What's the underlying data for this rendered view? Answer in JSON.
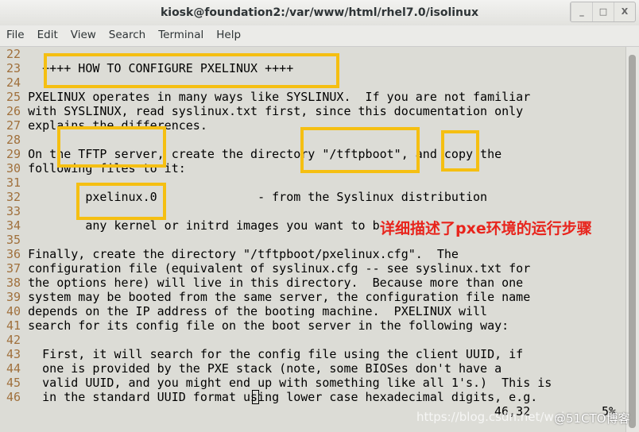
{
  "window": {
    "title": "kiosk@foundation2:/var/www/html/rhel7.0/isolinux",
    "buttons": [
      "_",
      "□",
      "X"
    ]
  },
  "menu": [
    "File",
    "Edit",
    "View",
    "Search",
    "Terminal",
    "Help"
  ],
  "lines": [
    {
      "n": "22",
      "t": ""
    },
    {
      "n": "23",
      "t": "  ++++ HOW TO CONFIGURE PXELINUX ++++"
    },
    {
      "n": "24",
      "t": ""
    },
    {
      "n": "25",
      "t": "PXELINUX operates in many ways like SYSLINUX.  If you are not familiar"
    },
    {
      "n": "26",
      "t": "with SYSLINUX, read syslinux.txt first, since this documentation only"
    },
    {
      "n": "27",
      "t": "explains the differences."
    },
    {
      "n": "28",
      "t": ""
    },
    {
      "n": "29",
      "t": "On the TFTP server, create the directory \"/tftpboot\", and copy the"
    },
    {
      "n": "30",
      "t": "following files to it:"
    },
    {
      "n": "31",
      "t": ""
    },
    {
      "n": "32",
      "t": "        pxelinux.0              - from the Syslinux distribution"
    },
    {
      "n": "33",
      "t": ""
    },
    {
      "n": "34",
      "t": "        any kernel or initrd images you want to boot"
    },
    {
      "n": "35",
      "t": ""
    },
    {
      "n": "36",
      "t": "Finally, create the directory \"/tftpboot/pxelinux.cfg\".  The"
    },
    {
      "n": "37",
      "t": "configuration file (equivalent of syslinux.cfg -- see syslinux.txt for"
    },
    {
      "n": "38",
      "t": "the options here) will live in this directory.  Because more than one"
    },
    {
      "n": "39",
      "t": "system may be booted from the same server, the configuration file name"
    },
    {
      "n": "40",
      "t": "depends on the IP address of the booting machine.  PXELINUX will"
    },
    {
      "n": "41",
      "t": "search for its config file on the boot server in the following way:"
    },
    {
      "n": "42",
      "t": ""
    },
    {
      "n": "43",
      "t": "  First, it will search for the config file using the client UUID, if"
    },
    {
      "n": "44",
      "t": "  one is provided by the PXE stack (note, some BIOSes don't have a"
    },
    {
      "n": "45",
      "t": "  valid UUID, and you might end up with something like all 1's.)  This is"
    },
    {
      "n": "46",
      "t": "  in the standard UUID format using lower case hexadecimal digits, e.g."
    }
  ],
  "status": {
    "position": "46,32",
    "percent": "5%"
  },
  "annotation": {
    "text": "详细描述了pxe环境的运行步骤",
    "color": "#e8241c",
    "box_color": "#f5bf12"
  },
  "watermark": {
    "url": "https://blog.csdn.net/wei",
    "brand": "@51CTO博客"
  }
}
